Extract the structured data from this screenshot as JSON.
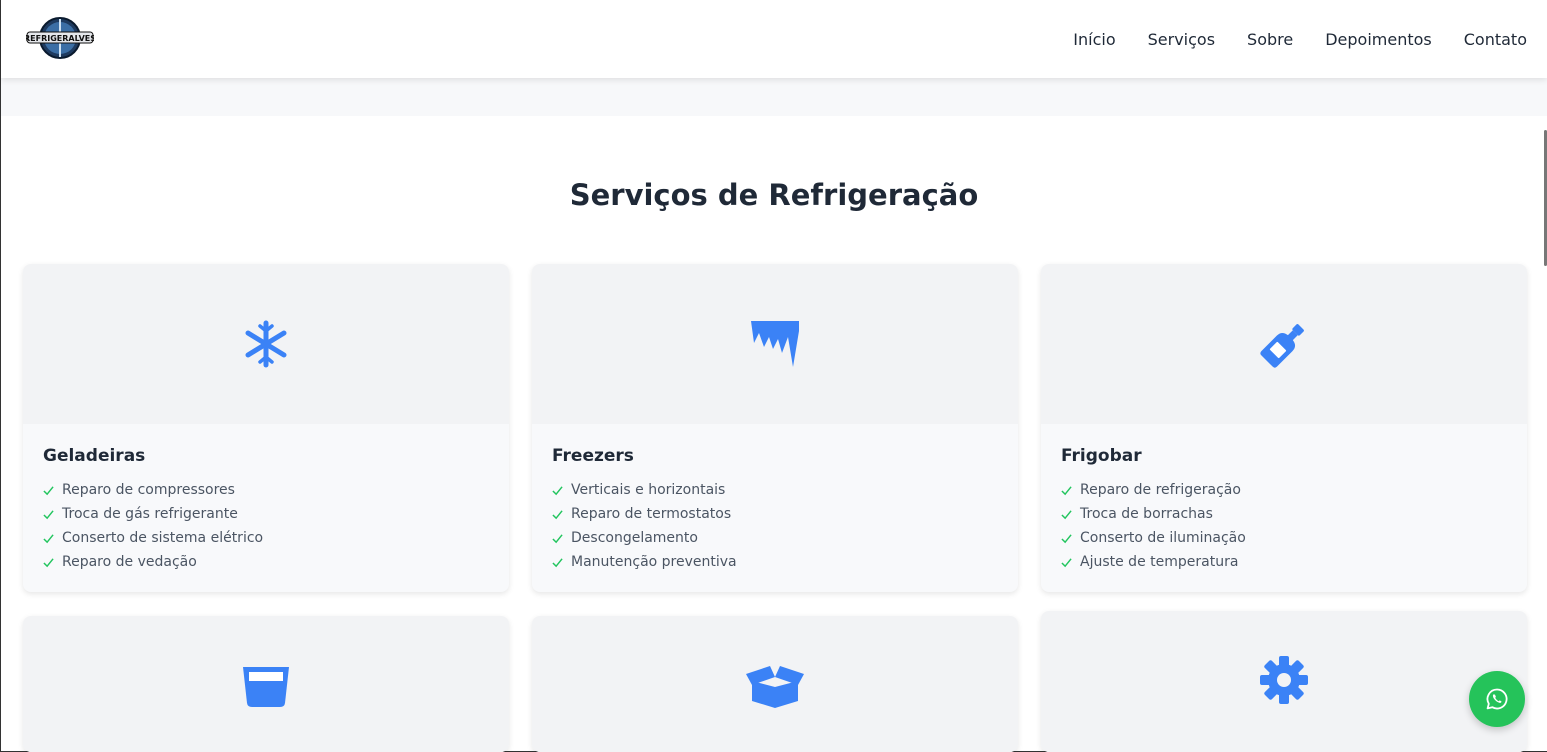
{
  "header": {
    "logo_text": "REFRIGERALVES",
    "nav": [
      "Início",
      "Serviços",
      "Sobre",
      "Depoimentos",
      "Contato"
    ]
  },
  "services": {
    "title": "Serviços de Refrigeração",
    "cards": [
      {
        "title": "Geladeiras",
        "icon": "snowflake-icon",
        "items": [
          "Reparo de compressores",
          "Troca de gás refrigerante",
          "Conserto de sistema elétrico",
          "Reparo de vedação"
        ]
      },
      {
        "title": "Freezers",
        "icon": "icicles-icon",
        "items": [
          "Verticais e horizontais",
          "Reparo de termostatos",
          "Descongelamento",
          "Manutenção preventiva"
        ]
      },
      {
        "title": "Frigobar",
        "icon": "bottle-icon",
        "items": [
          "Reparo de refrigeração",
          "Troca de borrachas",
          "Conserto de iluminação",
          "Ajuste de temperatura"
        ]
      }
    ],
    "partial_cards": [
      {
        "icon": "glass-icon"
      },
      {
        "icon": "box-open-icon"
      },
      {
        "icon": "gear-icon"
      }
    ]
  },
  "colors": {
    "accent": "#3b82f6",
    "check": "#22c55e",
    "whatsapp": "#25c35a"
  },
  "whatsapp_icon": "whatsapp-icon"
}
